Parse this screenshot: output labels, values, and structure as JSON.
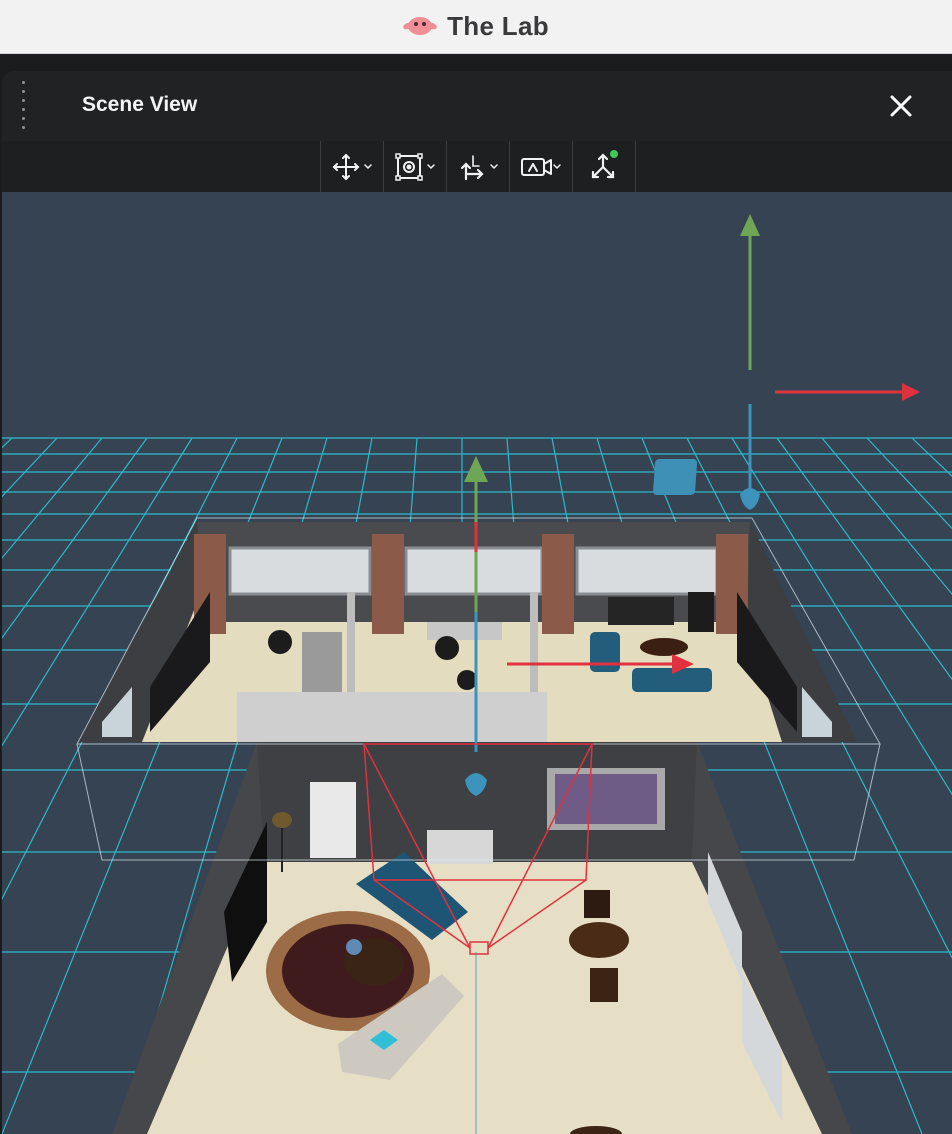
{
  "app": {
    "title": "The Lab",
    "logo_icon": "pink-creature-icon"
  },
  "panel": {
    "title": "Scene View",
    "drag_icon": "vertical-dots-icon",
    "close_icon": "close-icon"
  },
  "toolbar": {
    "tools": [
      {
        "icon": "move-arrows-icon",
        "has_dropdown": true
      },
      {
        "icon": "frame-select-icon",
        "has_dropdown": true
      },
      {
        "icon": "snap-axis-icon",
        "has_dropdown": true
      },
      {
        "icon": "camera-icon",
        "has_dropdown": true
      },
      {
        "icon": "gizmo-axes-icon",
        "has_dropdown": false,
        "status": "active"
      }
    ]
  },
  "viewport": {
    "scene": "3d-office-apartment-model",
    "colors": {
      "background": "#364352",
      "grid": "#2cc6d8",
      "axis_x": "#e0313f",
      "axis_y": "#6ea655",
      "axis_z": "#3d93bb",
      "floor": "#e6dfc6",
      "wall": "#46474a",
      "camera_frustum": "#e0313f"
    }
  }
}
